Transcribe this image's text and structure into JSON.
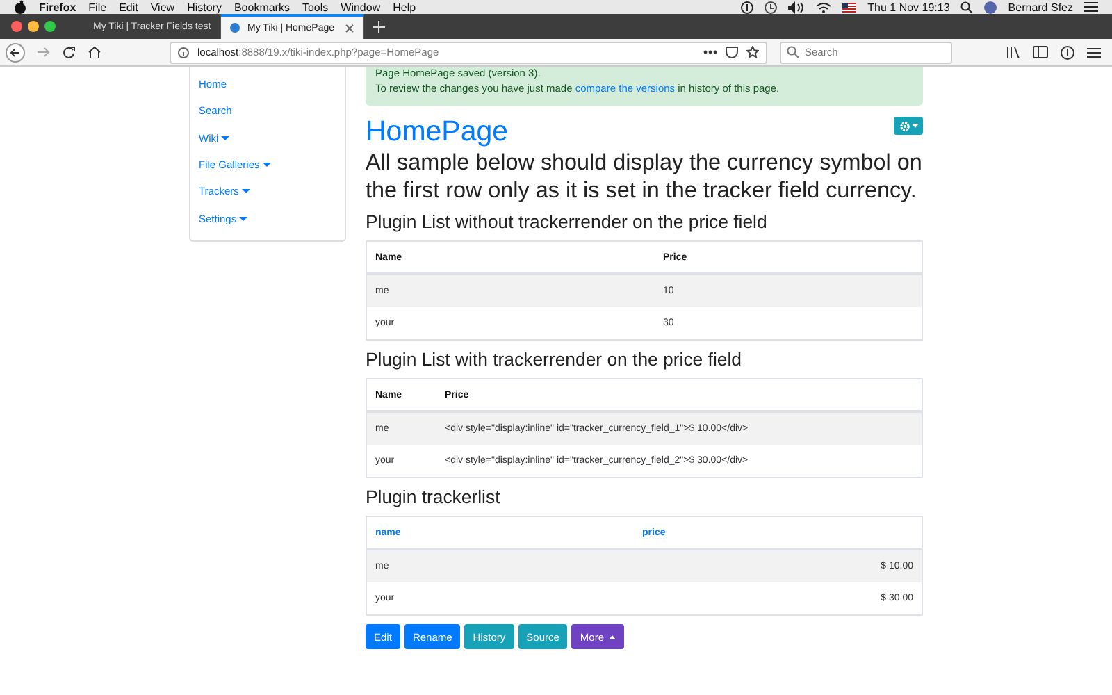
{
  "menu_bar": {
    "app": "Firefox",
    "items": [
      "File",
      "Edit",
      "View",
      "History",
      "Bookmarks",
      "Tools",
      "Window",
      "Help"
    ],
    "clock": "Thu 1 Nov 19:13",
    "user": "Bernard Sfez"
  },
  "tabs": [
    {
      "label": "My Tiki | Tracker Fields test",
      "selected": false
    },
    {
      "label": "My Tiki | HomePage",
      "selected": true
    }
  ],
  "address_bar": {
    "url": "**localhost**:8888/19.x/tiki-index.php?page=HomePage"
  },
  "search": {
    "placeholder": "Search"
  },
  "sidebar": {
    "items": [
      {
        "label": "Home",
        "has_menu": false
      },
      {
        "label": "Search",
        "has_menu": false
      },
      {
        "label": "Wiki",
        "has_menu": true
      },
      {
        "label": "File Galleries",
        "has_menu": true
      },
      {
        "label": "Trackers",
        "has_menu": true
      },
      {
        "label": "Settings",
        "has_menu": true
      }
    ]
  },
  "alert": {
    "lines": [
      "Page HomePage saved (version 3).",
      "To review the changes you have just made "
    ],
    "link": "compare the versions",
    "after_link": " in history of this page."
  },
  "page": {
    "title": "HomePage",
    "intro": "All sample below should display the currency symbol on the first row only as it is set in the tracker field currency."
  },
  "sections": [
    {
      "heading": "Plugin List without trackerrender on the price field",
      "kind": "list",
      "columns": [
        "Name",
        "Price"
      ],
      "rows": [
        [
          "me",
          "10"
        ],
        [
          "your",
          "30"
        ]
      ]
    },
    {
      "heading": "Plugin List with trackerrender on the price field",
      "kind": "render",
      "columns": [
        "Name",
        "Price"
      ],
      "rows": [
        [
          "me",
          "<div style=\"display:inline\" id=\"tracker_currency_field_1\">$ 10.00</div>"
        ],
        [
          "your",
          "<div style=\"display:inline\" id=\"tracker_currency_field_2\">$ 30.00</div>"
        ]
      ]
    },
    {
      "heading": "Plugin trackerlist",
      "kind": "trackerlist",
      "columns": [
        "name",
        "price"
      ],
      "rows": [
        [
          "me",
          "$ 10.00"
        ],
        [
          "your",
          "$ 30.00"
        ]
      ]
    }
  ],
  "buttons": [
    {
      "label": "Edit",
      "kind": "primary"
    },
    {
      "label": "Rename",
      "kind": "primary"
    },
    {
      "label": "History",
      "kind": "info"
    },
    {
      "label": "Source",
      "kind": "info"
    },
    {
      "label": "More",
      "kind": "menu"
    }
  ]
}
